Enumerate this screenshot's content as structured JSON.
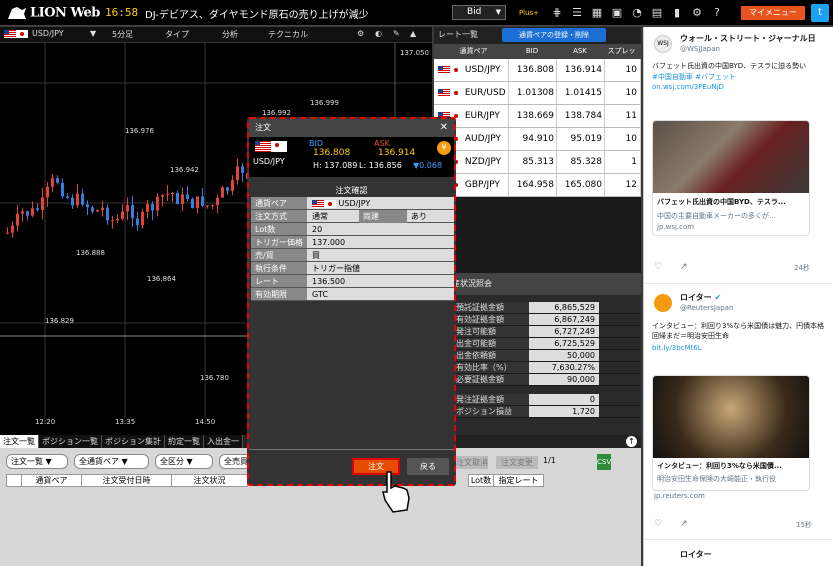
{
  "header": {
    "logo": "LION Web",
    "clock": "16:58",
    "news": "DJ-デビアス、ダイヤモンド原石の売り上げが減少",
    "bid_select": "Bid",
    "plus_label": "Plus+",
    "mypage": "マイメニュー"
  },
  "chart_toolbar": {
    "pair": "USD/JPY",
    "interval": "5分足",
    "type": "タイプ",
    "analysis": "分析",
    "technical": "テクニカル"
  },
  "chart": {
    "price_labels": [
      "137.050",
      "136.992",
      "136.999",
      "136.976",
      "136.942",
      "136.888",
      "136.864",
      "136.829",
      "136.780"
    ],
    "time_labels": [
      "12:20",
      "13:35",
      "14:50"
    ]
  },
  "rate_panel": {
    "tab": "レート一覧",
    "button": "通貨ペアの登録・削除",
    "headers": [
      "通貨ペア",
      "BID",
      "ASK",
      "スプレッ"
    ],
    "rows": [
      {
        "pair": "USD/JPY",
        "bid": "136.808",
        "ask": "136.914",
        "spread": "10"
      },
      {
        "pair": "EUR/USD",
        "bid": "1.01308",
        "ask": "1.01415",
        "spread": "10"
      },
      {
        "pair": "EUR/JPY",
        "bid": "138.669",
        "ask": "138.784",
        "spread": "11"
      },
      {
        "pair": "AUD/JPY",
        "bid": "94.910",
        "ask": "95.019",
        "spread": "10"
      },
      {
        "pair": "NZD/JPY",
        "bid": "85.313",
        "ask": "85.328",
        "spread": "1"
      },
      {
        "pair": "GBP/JPY",
        "bid": "164.958",
        "ask": "165.080",
        "spread": "12"
      }
    ]
  },
  "asset_panel": {
    "title": "産状況照会",
    "rows": [
      {
        "label": "預託証拠金額",
        "value": "6,865,529"
      },
      {
        "label": "有効証拠金額",
        "value": "6,867,249"
      },
      {
        "label": "発注可能額",
        "value": "6,727,249"
      },
      {
        "label": "出金可能額",
        "value": "6,725,529"
      },
      {
        "label": "出金依頼額",
        "value": "50,000"
      },
      {
        "label": "有効比率（%）",
        "value": "7,630.27%"
      },
      {
        "label": "必要証拠金額",
        "value": "90,000"
      },
      {
        "label": "発注証拠金額",
        "value": "0"
      },
      {
        "label": "ポジション損益",
        "value": "1,720"
      }
    ]
  },
  "bottom": {
    "tabs": [
      "注文一覧",
      "ポジション一覧",
      "ポジション集計",
      "約定一覧",
      "入出金一"
    ],
    "selects": [
      "注文一覧",
      "全通貨ペア",
      "全区分",
      "全売買"
    ],
    "headers": [
      "通貨ペア",
      "注文受付日時",
      "注文状況",
      "Lot数",
      "指定レート"
    ],
    "cancel": "注文取消",
    "change": "注文変更",
    "pages": "1/1"
  },
  "modal": {
    "title": "注文",
    "pair": "USD/JPY",
    "bid_label": "BID",
    "bid": "136.808",
    "ask_label": "ASK",
    "ask": "136.914",
    "high": "H: 137.089",
    "low": "L: 136.856",
    "change": "▼0.068",
    "confirm_title": "注文確認",
    "rows": [
      {
        "label": "通貨ペア",
        "value": "USD/JPY"
      },
      {
        "label": "注文方式",
        "value": "通常",
        "extra_label": "両建",
        "extra_value": "あり"
      },
      {
        "label": "Lot数",
        "value": "20"
      },
      {
        "label": "トリガー価格",
        "value": "137.000"
      },
      {
        "label": "売/買",
        "value": "買"
      },
      {
        "label": "執行条件",
        "value": "トリガー指値"
      },
      {
        "label": "レート",
        "value": "136.500"
      },
      {
        "label": "有効期限",
        "value": "GTC"
      }
    ],
    "order_button": "注文",
    "back_button": "戻る"
  },
  "twitter": {
    "tweet1": {
      "name": "ウォール・ストリート・ジャーナル日",
      "handle": "@WSJJapan",
      "text": "バフェット氏出資の中国BYD、テスラに迫る勢い",
      "tags": "#中国自動車 #バフェット",
      "link": "on.wsj.com/3PEuNjD",
      "card_title": "バフェット氏出資の中国BYD、テスラ...",
      "card_desc": "中国の主要自動車メーカーの多くが…",
      "card_domain": "jp.wsj.com",
      "time": "24秒"
    },
    "tweet2": {
      "name": "ロイター",
      "handle": "@ReutersJapan",
      "text": "インタビュー：利回り3%なら米国債は魅力、円債本格回帰まだ＝明治安田生命",
      "link": "bit.ly/3bcMt6L",
      "card_title": "インタビュー：利回り3%なら米国債...",
      "card_desc": "明治安田生命保険の大崎能正・執行役",
      "card_domain": "jp.reuters.com",
      "time": "15秒"
    },
    "tweet3": {
      "name": "ロイター"
    }
  }
}
